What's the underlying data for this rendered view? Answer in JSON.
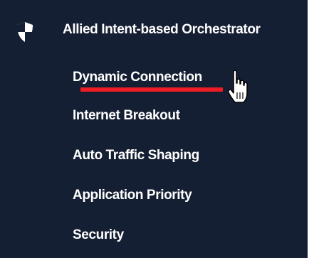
{
  "menu": {
    "header": {
      "icon": "shield-icon",
      "title": "Allied Intent-based Orchestrator"
    },
    "items": [
      {
        "label": "Dynamic Connection",
        "highlighted": true
      },
      {
        "label": "Internet Breakout"
      },
      {
        "label": "Auto Traffic Shaping"
      },
      {
        "label": "Application Priority"
      },
      {
        "label": "Security"
      }
    ]
  },
  "overlay": {
    "cursor_icon": "hand-pointer-icon",
    "underline_color": "#ee1c24"
  },
  "colors": {
    "sidebar_background": "#151f33",
    "text": "#ffffff"
  }
}
